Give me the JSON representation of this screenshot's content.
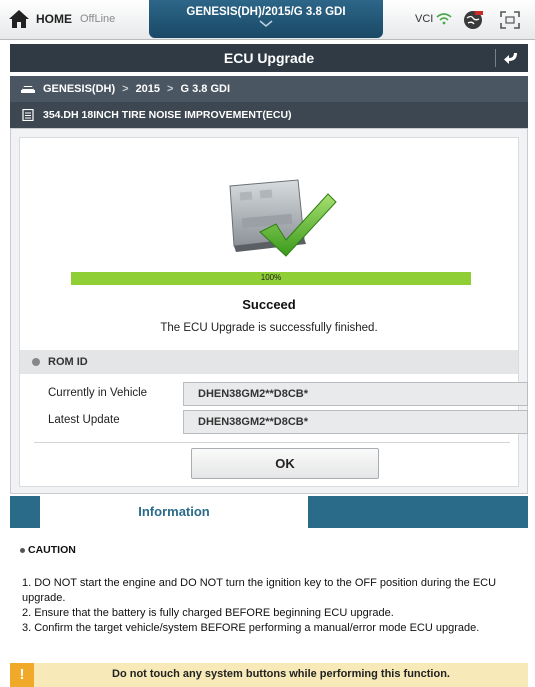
{
  "header": {
    "home_label": "HOME",
    "mode_label": "OffLine",
    "vehicle_title": "GENESIS(DH)/2015/G 3.8 GDI",
    "vci_label": "VCI"
  },
  "title_bar": {
    "title": "ECU Upgrade"
  },
  "breadcrumb": {
    "model": "GENESIS(DH)",
    "year": "2015",
    "engine": "G 3.8 GDI",
    "separator": ">",
    "document": "354.DH 18INCH TIRE NOISE IMPROVEMENT(ECU)"
  },
  "result": {
    "progress_percent": 100,
    "progress_label": "100%",
    "status": "Succeed",
    "message": "The ECU Upgrade is successfully finished.",
    "progress_color": "#8fce35"
  },
  "rom_id": {
    "section_label": "ROM ID",
    "current_label": "Currently in Vehicle",
    "current_value": "DHEN38GM2**D8CB*",
    "latest_label": "Latest Update",
    "latest_value": "DHEN38GM2**D8CB*"
  },
  "actions": {
    "ok_label": "OK"
  },
  "information": {
    "tab_label": "Information",
    "caution_title": "CAUTION",
    "lines": [
      "1. DO NOT start the engine and DO NOT turn the ignition key to the OFF position during the ECU upgrade.",
      "2. Ensure that the battery is fully charged BEFORE beginning ECU upgrade.",
      "3. Confirm the target vehicle/system BEFORE performing a manual/error mode ECU upgrade."
    ]
  },
  "footer": {
    "warning_symbol": "!",
    "warning_text": "Do not touch any system buttons while performing this function."
  },
  "colors": {
    "accent": "#2b6b8a",
    "title_bar": "#2f3a44",
    "warning": "#f1a92a"
  }
}
